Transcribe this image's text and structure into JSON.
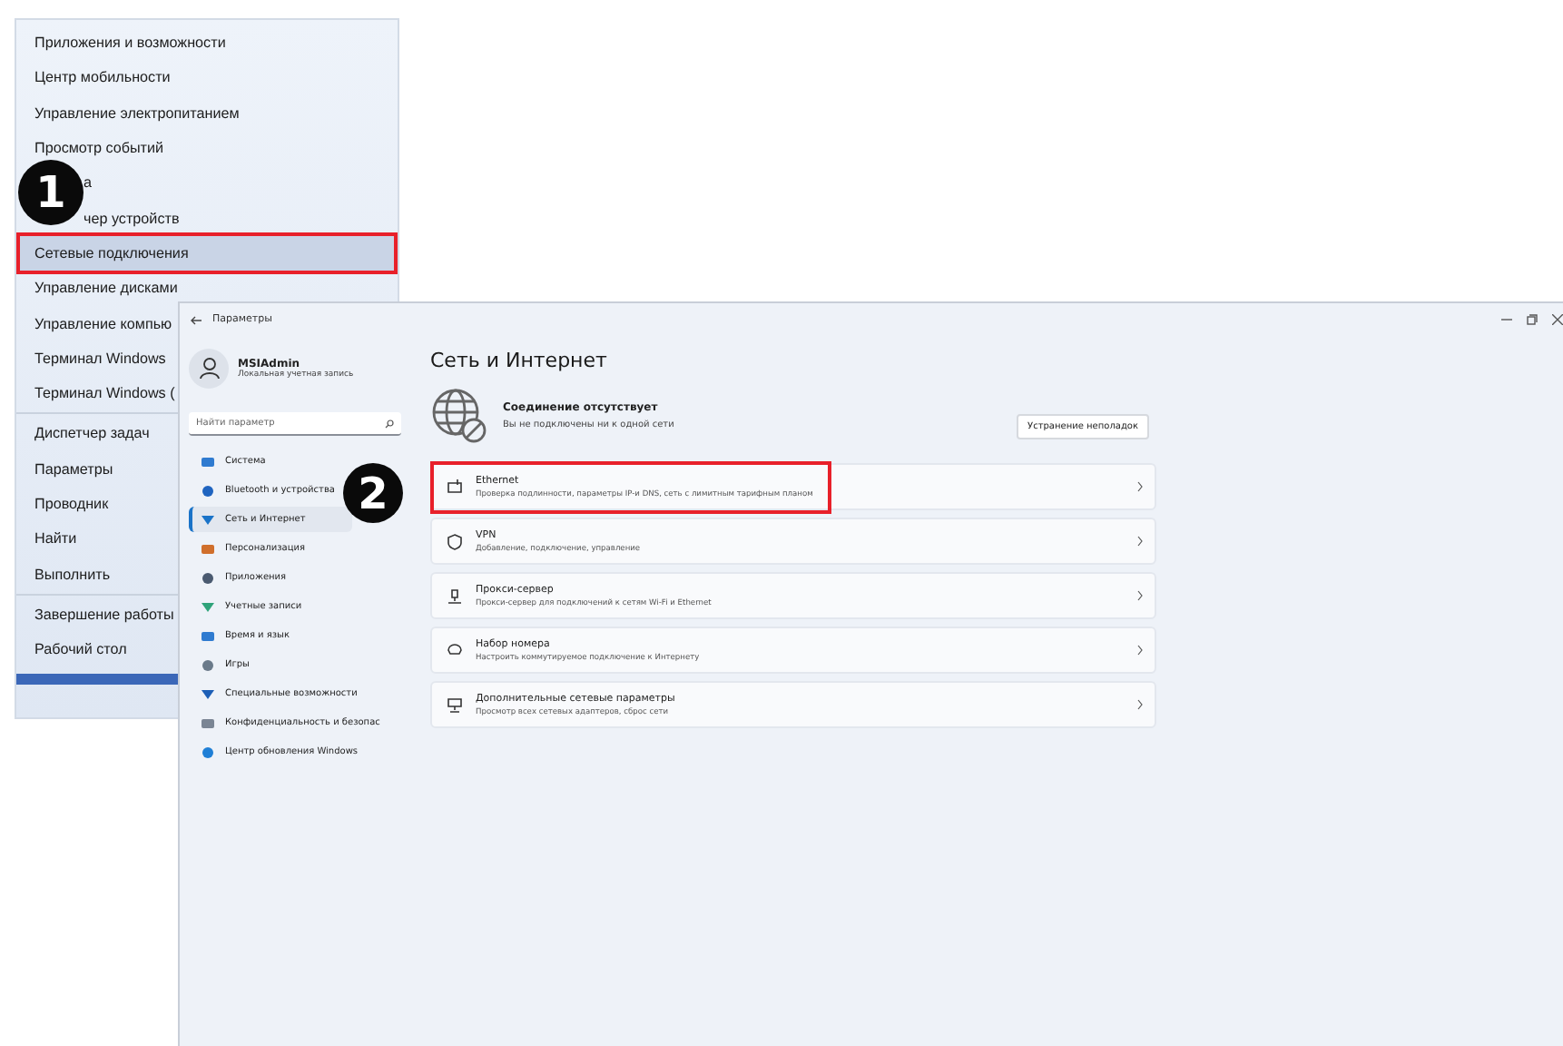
{
  "context_menu": {
    "groups": [
      [
        {
          "label": "Приложения и возможности",
          "highlighted": false,
          "kind": "plain"
        },
        {
          "label": "Центр мобильности",
          "highlighted": false,
          "kind": "plain"
        },
        {
          "label": "Управление электропитанием",
          "highlighted": false,
          "kind": "plain"
        },
        {
          "label": "Просмотр событий",
          "highlighted": false,
          "kind": "plain"
        },
        {
          "label": "а",
          "highlighted": false,
          "kind": "covered"
        },
        {
          "label": "чер устройств",
          "highlighted": false,
          "kind": "covered"
        },
        {
          "label": "Сетевые подключения",
          "highlighted": true,
          "kind": "plain"
        },
        {
          "label": "Управление дисками",
          "highlighted": false,
          "kind": "plain"
        },
        {
          "label": "Управление компью",
          "highlighted": false,
          "kind": "plain"
        },
        {
          "label": "Терминал Windows",
          "highlighted": false,
          "kind": "plain"
        },
        {
          "label": "Терминал Windows (",
          "highlighted": false,
          "kind": "plain"
        }
      ],
      [
        {
          "label": "Диспетчер задач",
          "highlighted": false,
          "kind": "plain"
        },
        {
          "label": "Параметры",
          "highlighted": false,
          "kind": "plain"
        },
        {
          "label": "Проводник",
          "highlighted": false,
          "kind": "plain"
        },
        {
          "label": "Найти",
          "highlighted": false,
          "kind": "plain"
        },
        {
          "label": "Выполнить",
          "highlighted": false,
          "kind": "plain"
        }
      ],
      [
        {
          "label": "Завершение работы",
          "highlighted": false,
          "kind": "plain"
        },
        {
          "label": "Рабочий стол",
          "highlighted": false,
          "kind": "plain"
        }
      ]
    ]
  },
  "step_badges": [
    "1",
    "2"
  ],
  "settings_window": {
    "title": "Параметры",
    "user": {
      "name": "MSIAdmin",
      "account": "Локальная учетная запись"
    },
    "search": {
      "placeholder": "Найти параметр"
    },
    "nav": [
      {
        "label": "Система",
        "selected": false
      },
      {
        "label": "Bluetooth и устройства",
        "selected": false
      },
      {
        "label": "Сеть и Интернет",
        "selected": true
      },
      {
        "label": "Персонализация",
        "selected": false
      },
      {
        "label": "Приложения",
        "selected": false
      },
      {
        "label": "Учетные записи",
        "selected": false
      },
      {
        "label": "Время и язык",
        "selected": false
      },
      {
        "label": "Игры",
        "selected": false
      },
      {
        "label": "Специальные возможности",
        "selected": false
      },
      {
        "label": "Конфиденциальность и безопас",
        "selected": false
      },
      {
        "label": "Центр обновления Windows",
        "selected": false
      }
    ],
    "page_title": "Сеть и Интернет",
    "status": {
      "title": "Соединение отсутствует",
      "subtitle": "Вы не подключены ни к одной сети",
      "button": "Устранение неполадок"
    },
    "cards": [
      {
        "title": "Ethernet",
        "subtitle": "Проверка подлинности, параметры IP-и DNS, сеть с лимитным тарифным планом",
        "highlighted": true
      },
      {
        "title": "VPN",
        "subtitle": "Добавление, подключение, управление",
        "highlighted": false
      },
      {
        "title": "Прокси-сервер",
        "subtitle": "Прокси-сервер для подключений к сетям Wi-Fi и Ethernet",
        "highlighted": false
      },
      {
        "title": "Набор номера",
        "subtitle": "Настроить коммутируемое подключение к Интернету",
        "highlighted": false
      },
      {
        "title": "Дополнительные сетевые параметры",
        "subtitle": "Просмотр всех сетевых адаптеров, сброс сети",
        "highlighted": false
      }
    ]
  }
}
